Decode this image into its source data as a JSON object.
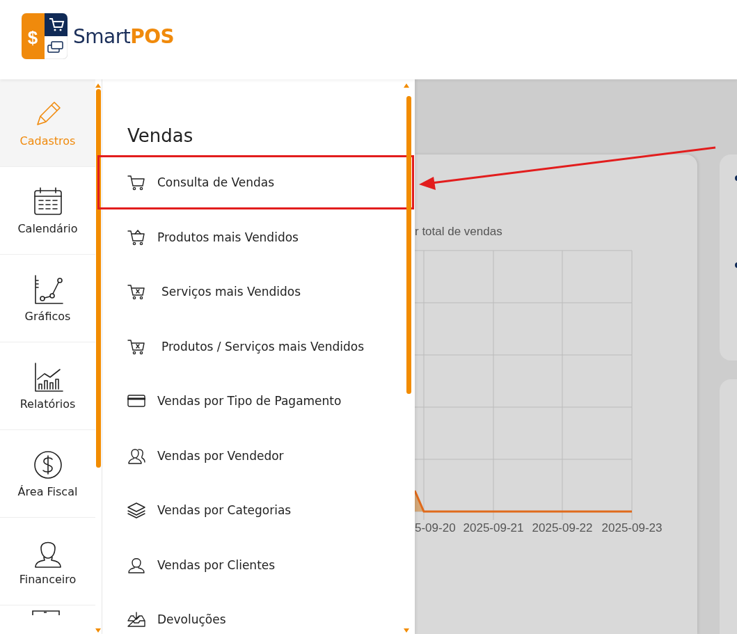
{
  "brand": {
    "logo_symbol": "$",
    "name": "Smart**POS**"
  },
  "sidebar": {
    "items": [
      {
        "label": "Cadastros",
        "selected": true
      },
      {
        "label": "Calendário",
        "selected": false
      },
      {
        "label": "Gráficos",
        "selected": false
      },
      {
        "label": "Relatórios",
        "selected": false
      },
      {
        "label": "Área Fiscal",
        "selected": false
      },
      {
        "label": "Financeiro",
        "selected": false
      }
    ]
  },
  "menu": {
    "title": "Vendas",
    "items": [
      {
        "label": "Consulta de Vendas",
        "highlighted": true
      },
      {
        "label": "Produtos mais Vendidos",
        "highlighted": false
      },
      {
        "label": "Serviços mais Vendidos",
        "highlighted": false
      },
      {
        "label": "Produtos / Serviços mais Vendidos",
        "highlighted": false
      },
      {
        "label": "Vendas por Tipo de Pagamento",
        "highlighted": false
      },
      {
        "label": "Vendas por Vendedor",
        "highlighted": false
      },
      {
        "label": "Vendas por Categorias",
        "highlighted": false
      },
      {
        "label": "Vendas por Clientes",
        "highlighted": false
      },
      {
        "label": "Devoluções",
        "highlighted": false
      }
    ]
  },
  "chart": {
    "title": "r total de vendas",
    "x_labels": [
      "5-09-20",
      "2025-09-21",
      "2025-09-22",
      "2025-09-23"
    ]
  }
}
